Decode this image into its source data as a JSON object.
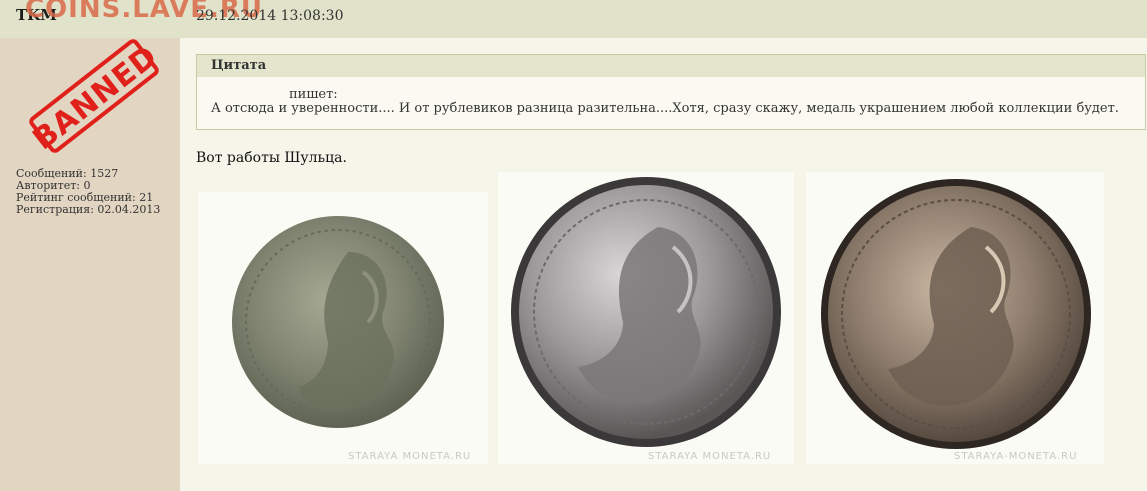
{
  "site": {
    "watermark": "COINS.LAVE.RU"
  },
  "user": {
    "name": "TKM",
    "banned_stamp": "BANNED",
    "stats": [
      "Сообщений: 1527",
      "Авторитет: 0",
      "Рейтинг сообщений: 21",
      "Регистрация: 02.04.2013"
    ]
  },
  "post": {
    "date": "29.12.2014 13:08:30",
    "quote": {
      "header": "Цитата",
      "author_line": "пишет:",
      "text": "А отсюда и уверенности.... И от рублевиков разница разительна....Хотя, сразу скажу, медаль украшением любой коллекции будет."
    },
    "text": "Вот работы Шульца.",
    "images": [
      {
        "caption": "STARAYA MONETA.RU",
        "icon": "coin-image"
      },
      {
        "caption": "STARAYA MONETA.RU",
        "icon": "coin-image"
      },
      {
        "caption": "STARAYA-MONETA.RU",
        "icon": "coin-image"
      }
    ]
  },
  "colors": {
    "sidebar": "#e2d5c2",
    "header": "#e0e2c9",
    "stamp": "#e0201b",
    "watermark": "#d96b4a"
  }
}
